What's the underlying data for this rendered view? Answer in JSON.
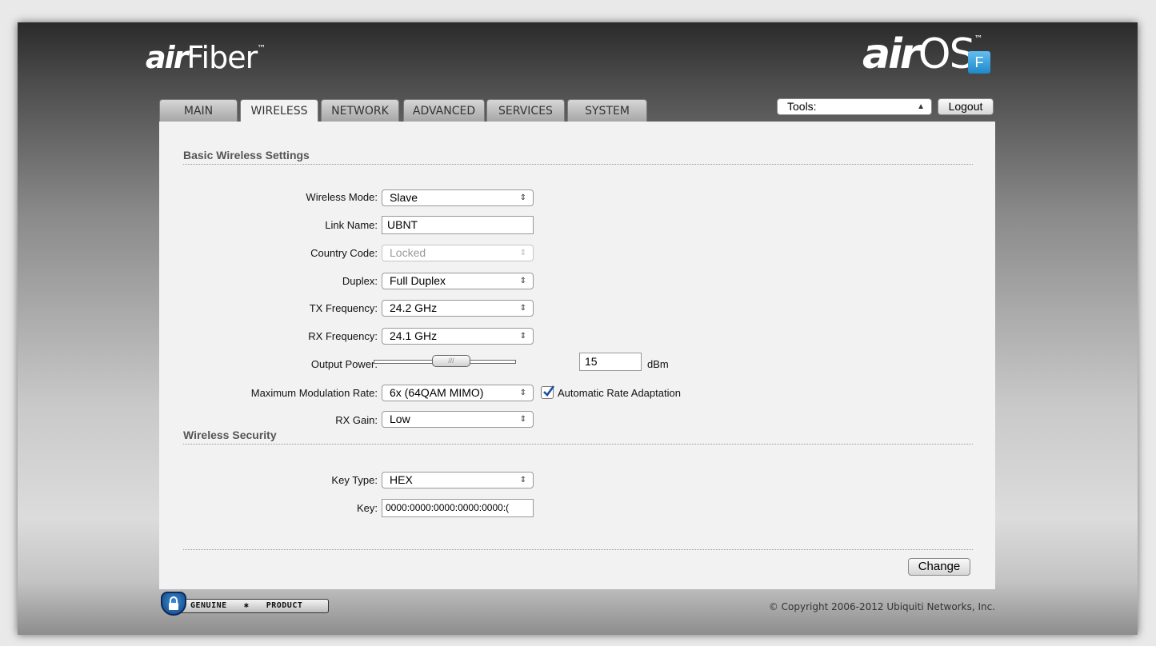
{
  "header": {
    "left_logo": {
      "prefix": "air",
      "name": "Fiber",
      "tm": "™"
    },
    "right_logo": {
      "prefix": "air",
      "name": "OS",
      "tm": "™",
      "badge": "F"
    }
  },
  "tabs": [
    {
      "label": "MAIN",
      "active": false
    },
    {
      "label": "WIRELESS",
      "active": true
    },
    {
      "label": "NETWORK",
      "active": false
    },
    {
      "label": "ADVANCED",
      "active": false
    },
    {
      "label": "SERVICES",
      "active": false
    },
    {
      "label": "SYSTEM",
      "active": false
    }
  ],
  "tools": {
    "value": "Tools:",
    "logout_label": "Logout"
  },
  "basic": {
    "title": "Basic Wireless Settings",
    "wireless_mode": {
      "label": "Wireless Mode:",
      "value": "Slave"
    },
    "link_name": {
      "label": "Link Name:",
      "value": "UBNT"
    },
    "country_code": {
      "label": "Country Code:",
      "value": "Locked"
    },
    "duplex": {
      "label": "Duplex:",
      "value": "Full Duplex"
    },
    "tx_frequency": {
      "label": "TX Frequency:",
      "value": "24.2 GHz"
    },
    "rx_frequency": {
      "label": "RX Frequency:",
      "value": "24.1 GHz"
    },
    "output_power": {
      "label": "Output Power:",
      "value": "15",
      "unit": "dBm",
      "slider_level": 0.41
    },
    "max_modulation": {
      "label": "Maximum Modulation Rate:",
      "value": "6x (64QAM MIMO)"
    },
    "auto_rate": {
      "label": "Automatic Rate Adaptation",
      "checked": true
    },
    "rx_gain": {
      "label": "RX Gain:",
      "value": "Low"
    }
  },
  "security": {
    "title": "Wireless Security",
    "key_type": {
      "label": "Key Type:",
      "value": "HEX"
    },
    "key": {
      "label": "Key:",
      "value": "0000:0000:0000:0000:0000:("
    }
  },
  "actions": {
    "change_label": "Change"
  },
  "footer": {
    "genuine_left": "GENUINE",
    "genuine_right": "PRODUCT",
    "copyright": "© Copyright 2006-2012 Ubiquiti Networks, Inc."
  }
}
